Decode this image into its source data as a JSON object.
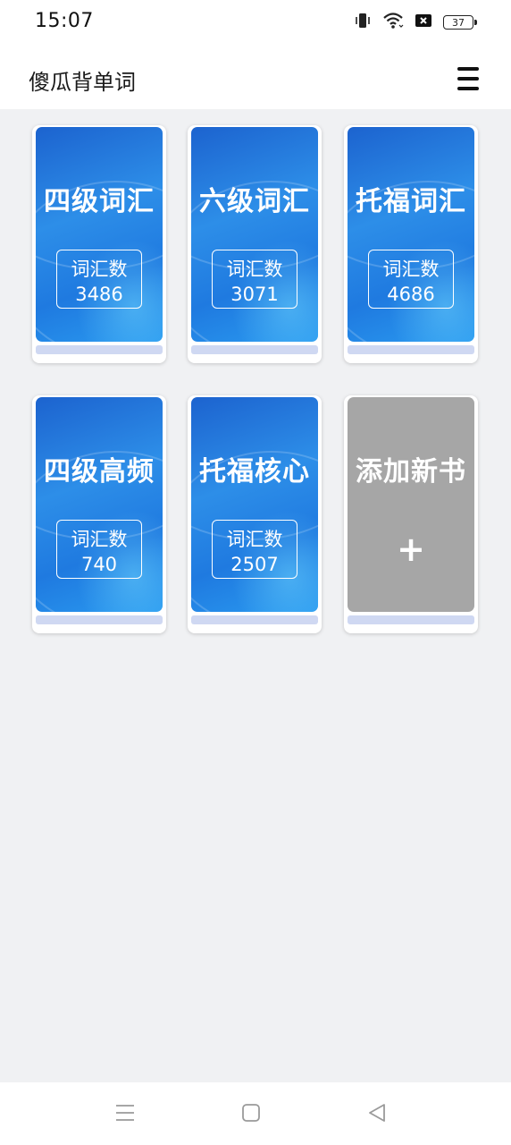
{
  "status_bar": {
    "time": "15:07",
    "battery_level": "37",
    "icons": [
      "vibrate-icon",
      "wifi-icon",
      "sim-off-icon",
      "battery-icon"
    ]
  },
  "app_bar": {
    "title": "傻瓜背单词",
    "menu_icon": "hamburger-menu-icon"
  },
  "books": [
    {
      "title": "四级词汇",
      "count_label": "词汇数",
      "count": "3486"
    },
    {
      "title": "六级词汇",
      "count_label": "词汇数",
      "count": "3071"
    },
    {
      "title": "托福词汇",
      "count_label": "词汇数",
      "count": "4686"
    },
    {
      "title": "四级高频",
      "count_label": "词汇数",
      "count": "740"
    },
    {
      "title": "托福核心",
      "count_label": "词汇数",
      "count": "2507"
    }
  ],
  "add_book": {
    "title": "添加新书",
    "plus": "+"
  },
  "colors": {
    "cover_blue": "#2d8ee8",
    "add_gray": "#a6a6a6",
    "background": "#f0f1f3"
  },
  "nav_bar": {
    "icons": [
      "recent-apps-icon",
      "home-icon",
      "back-icon"
    ]
  }
}
